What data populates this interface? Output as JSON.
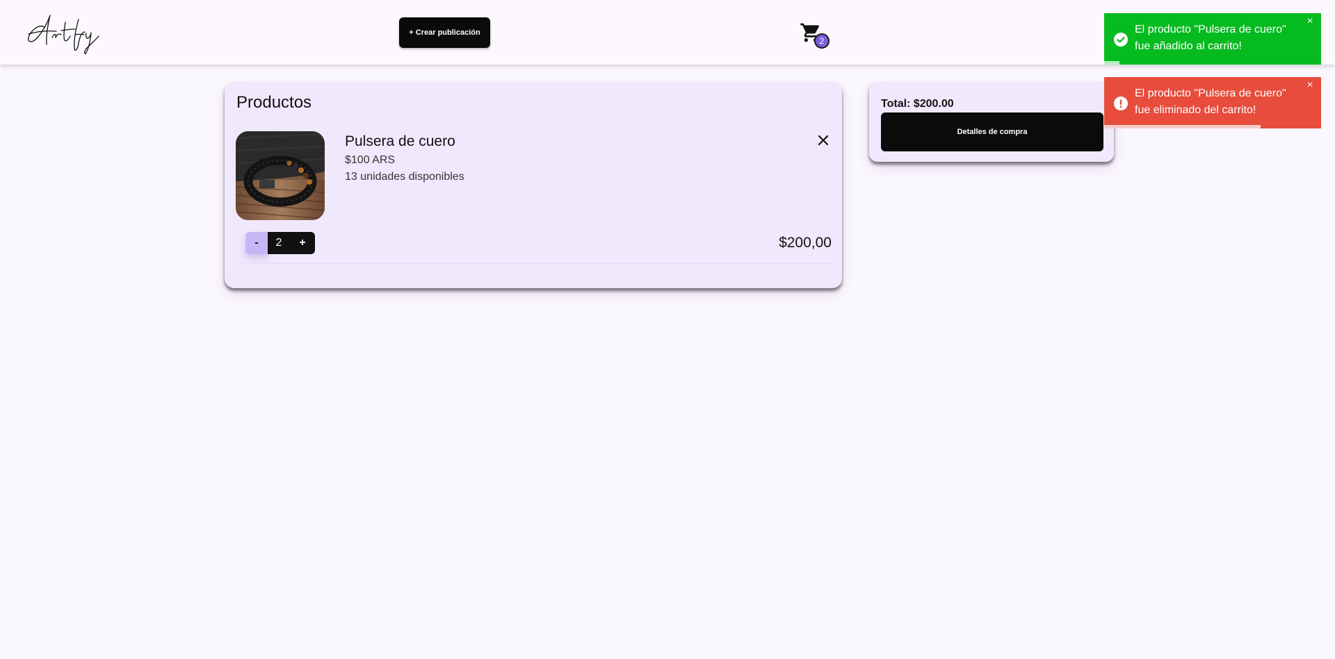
{
  "header": {
    "logo_text": "Artfy",
    "create_button_label": "+ Crear publicación",
    "cart_count": "2"
  },
  "products": {
    "title": "Productos",
    "items": [
      {
        "name": "Pulsera de cuero",
        "price": "$100 ARS",
        "stock": "13 unidades disponibles",
        "quantity": "2",
        "minus_label": "-",
        "plus_label": "+",
        "line_total": "$200,00",
        "image": "leather-bracelet-image"
      }
    ]
  },
  "summary": {
    "total": "Total: $200.00",
    "details_button_label": "Detalles de compra"
  },
  "toasts": [
    {
      "type": "success",
      "icon": "check-circle-icon",
      "message": "El producto \"Pulsera de cuero\" fue añadido al carrito!",
      "close_label": "×",
      "progress": 0.07
    },
    {
      "type": "error",
      "icon": "alert-circle-icon",
      "message": "El producto \"Pulsera de cuero\" fue eliminado del carrito!",
      "close_label": "×",
      "progress": 0.72
    }
  ],
  "colors": {
    "accent": "#7b5ee0",
    "page_background": "#fbf7fe",
    "card_background": "#f0e9fd",
    "success": "#06bb1f",
    "error": "#e74c3c",
    "button_dark": "#0b0b0b"
  }
}
